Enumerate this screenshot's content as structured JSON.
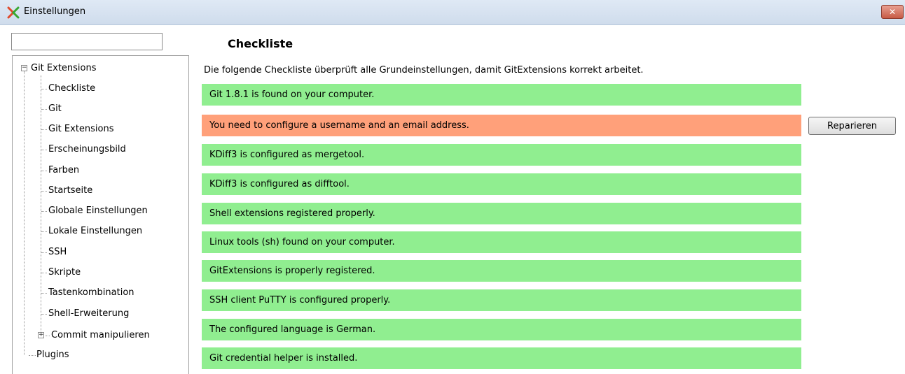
{
  "window": {
    "title": "Einstellungen",
    "close_glyph": "✕"
  },
  "search": {
    "value": "",
    "placeholder": ""
  },
  "tree": {
    "root": "Git Extensions",
    "children": [
      "Checkliste",
      "Git",
      "Git Extensions",
      "Erscheinungsbild",
      "Farben",
      "Startseite",
      "Globale Einstellungen",
      "Lokale Einstellungen",
      "SSH",
      "Skripte",
      "Tastenkombination",
      "Shell-Erweiterung",
      "Commit manipulieren"
    ],
    "plugins": "Plugins",
    "expander_minus": "−",
    "expander_plus": "+"
  },
  "main": {
    "heading": "Checkliste",
    "description": "Die folgende Checkliste überprüft alle Grundeinstellungen, damit GitExtensions korrekt arbeitet.",
    "checks": [
      {
        "text": "Git 1.8.1 is found on your computer.",
        "status": "ok"
      },
      {
        "text": "You need to configure a username and an email address.",
        "status": "error"
      },
      {
        "text": "KDiff3 is configured as mergetool.",
        "status": "ok"
      },
      {
        "text": "KDiff3 is configured as difftool.",
        "status": "ok"
      },
      {
        "text": "Shell extensions registered properly.",
        "status": "ok"
      },
      {
        "text": "Linux tools (sh) found on your computer.",
        "status": "ok"
      },
      {
        "text": "GitExtensions is properly registered.",
        "status": "ok"
      },
      {
        "text": "SSH client PuTTY is configured properly.",
        "status": "ok"
      },
      {
        "text": "The configured language is German.",
        "status": "ok"
      },
      {
        "text": "Git credential helper is installed.",
        "status": "ok"
      }
    ],
    "repair_label": "Reparieren"
  },
  "colors": {
    "ok": "#90ee90",
    "error": "#ffa07a"
  },
  "icons": {
    "app": "git-extensions-logo-icon",
    "close": "close-icon"
  }
}
